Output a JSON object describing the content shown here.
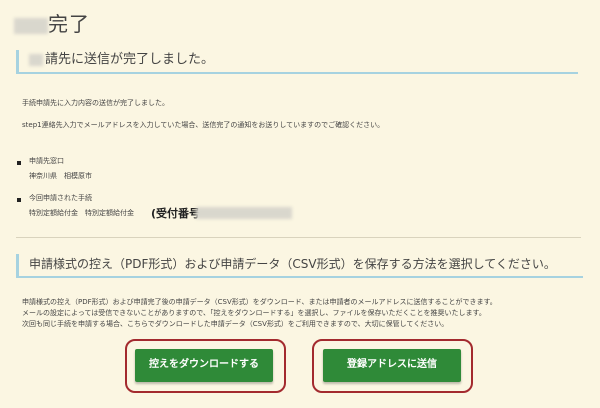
{
  "page": {
    "title_visible": "完了"
  },
  "sent_notice": {
    "heading": "請先に送信が完了しました。",
    "line1": "手続申請先に入力内容の送信が完了しました。",
    "line2": "step1連絡先入力でメールアドレスを入力していた場合、送信完了の通知をお送りしていますのでご確認ください。"
  },
  "details": {
    "destination_label": "申請先窓口",
    "destination_value": "神奈川県　相模原市",
    "procedure_label": "今回申請された手続",
    "procedure_value": "特別定額給付金　特別定額給付金",
    "receipt_label": "(受付番号"
  },
  "save_section": {
    "heading": "申請様式の控え（PDF形式）および申請データ（CSV形式）を保存する方法を選択してください。",
    "line1": "申請様式の控え（PDF形式）および申請完了後の申請データ（CSV形式）をダウンロード、または申請者のメールアドレスに送信することができます。",
    "line2": "メールの設定によっては受信できないことがありますので、「控えをダウンロードする」を選択し、ファイルを保存いただくことを推奨いたします。",
    "line3": "次回も同じ手続を申請する場合、こちらでダウンロードした申請データ（CSV形式）をご利用できますので、大切に保管してください。"
  },
  "buttons": {
    "download_label": "控えをダウンロードする",
    "send_label": "登録アドレスに送信"
  },
  "colors": {
    "background": "#fbf6e2",
    "accent_line": "#a6d2e0",
    "button_green": "#2f8a38",
    "highlight_red": "#a32a2e"
  }
}
